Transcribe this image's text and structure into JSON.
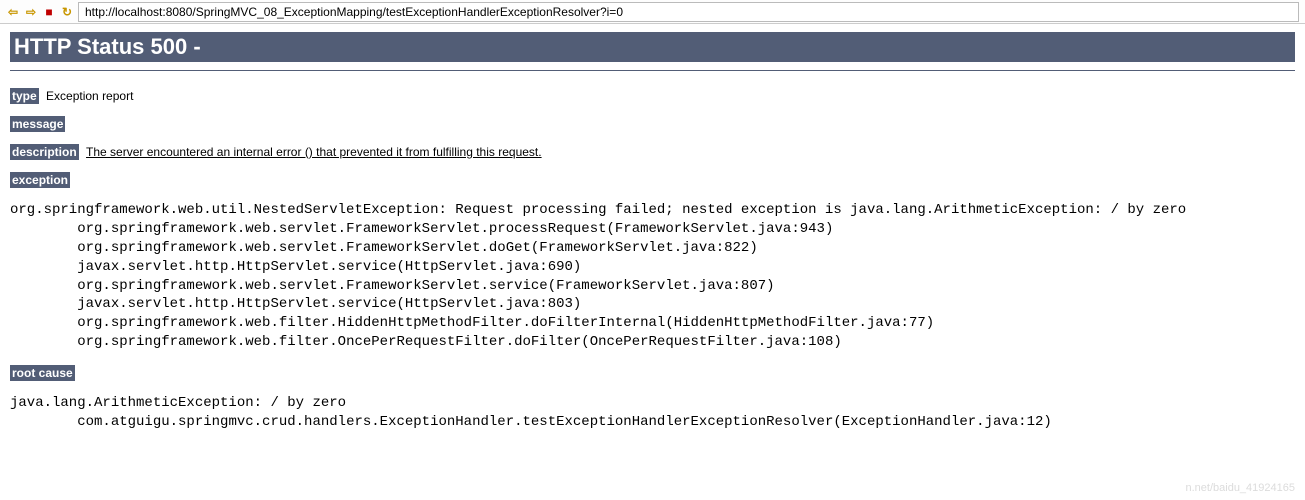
{
  "toolbar": {
    "back_glyph": "⇦",
    "forward_glyph": "⇨",
    "stop_glyph": "■",
    "refresh_glyph": "↻",
    "url": "http://localhost:8080/SpringMVC_08_ExceptionMapping/testExceptionHandlerExceptionResolver?i=0"
  },
  "page": {
    "status_header": "HTTP Status 500 -",
    "type_label": "type",
    "type_value": "Exception report",
    "message_label": "message",
    "description_label": "description",
    "description_value": "The server encountered an internal error () that prevented it from fulfilling this request.",
    "exception_label": "exception",
    "exception_trace": "org.springframework.web.util.NestedServletException: Request processing failed; nested exception is java.lang.ArithmeticException: / by zero\n\torg.springframework.web.servlet.FrameworkServlet.processRequest(FrameworkServlet.java:943)\n\torg.springframework.web.servlet.FrameworkServlet.doGet(FrameworkServlet.java:822)\n\tjavax.servlet.http.HttpServlet.service(HttpServlet.java:690)\n\torg.springframework.web.servlet.FrameworkServlet.service(FrameworkServlet.java:807)\n\tjavax.servlet.http.HttpServlet.service(HttpServlet.java:803)\n\torg.springframework.web.filter.HiddenHttpMethodFilter.doFilterInternal(HiddenHttpMethodFilter.java:77)\n\torg.springframework.web.filter.OncePerRequestFilter.doFilter(OncePerRequestFilter.java:108)",
    "root_cause_label": "root cause",
    "root_cause_trace": "java.lang.ArithmeticException: / by zero\n\tcom.atguigu.springmvc.crud.handlers.ExceptionHandler.testExceptionHandlerExceptionResolver(ExceptionHandler.java:12)"
  },
  "watermark": "n.net/baidu_41924165"
}
